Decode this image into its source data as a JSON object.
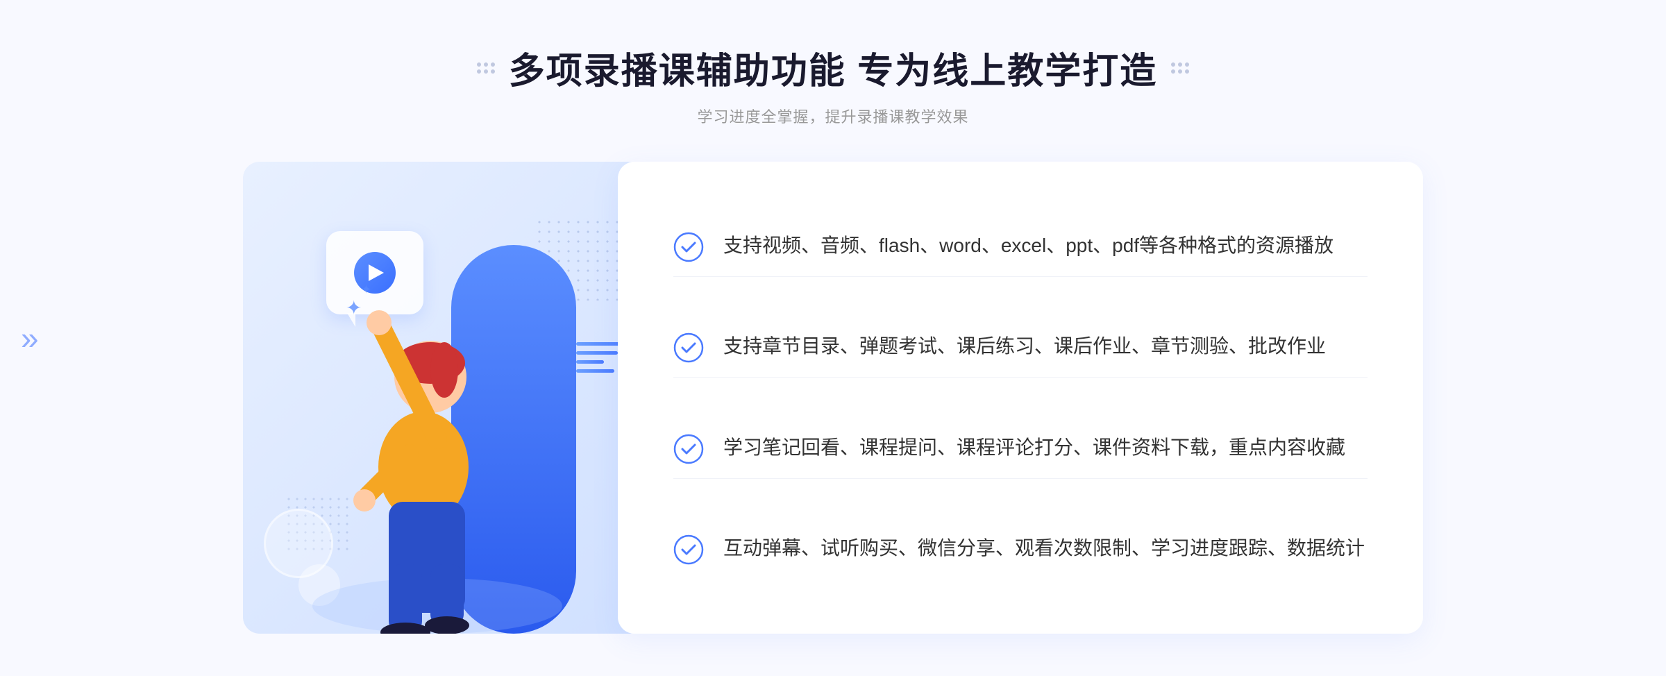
{
  "header": {
    "main_title": "多项录播课辅助功能 专为线上教学打造",
    "subtitle": "学习进度全掌握，提升录播课教学效果"
  },
  "features": [
    {
      "id": 1,
      "text": "支持视频、音频、flash、word、excel、ppt、pdf等各种格式的资源播放"
    },
    {
      "id": 2,
      "text": "支持章节目录、弹题考试、课后练习、课后作业、章节测验、批改作业"
    },
    {
      "id": 3,
      "text": "学习笔记回看、课程提问、课程评论打分、课件资料下载，重点内容收藏"
    },
    {
      "id": 4,
      "text": "互动弹幕、试听购买、微信分享、观看次数限制、学习进度跟踪、数据统计"
    }
  ],
  "decorations": {
    "left_arrow": "»",
    "accent_color": "#4a7aff",
    "light_blue": "#e8f0ff"
  }
}
